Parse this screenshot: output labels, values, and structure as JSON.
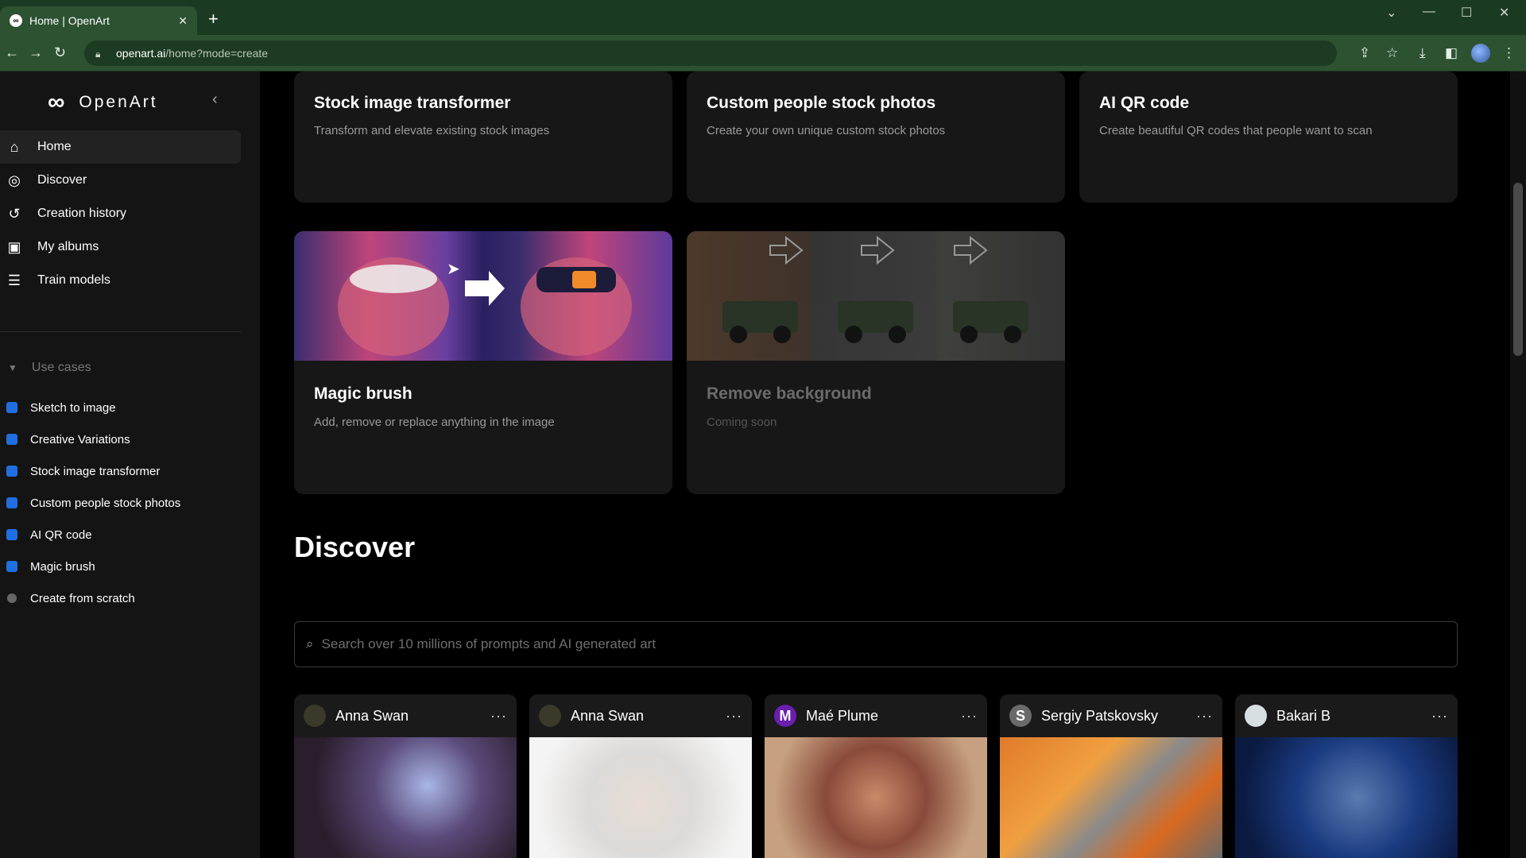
{
  "browser": {
    "tab_title": "Home | OpenArt",
    "tab_close": "✕",
    "new_tab": "+",
    "url_host": "openart.ai",
    "url_path": "/home?mode=create"
  },
  "sidebar": {
    "brand": "OpenArt",
    "nav": [
      {
        "label": "Home",
        "icon": "⌂"
      },
      {
        "label": "Discover",
        "icon": "◎"
      },
      {
        "label": "Creation history",
        "icon": "↺"
      },
      {
        "label": "My albums",
        "icon": "▣"
      },
      {
        "label": "Train models",
        "icon": "☰"
      }
    ],
    "use_cases_label": "Use cases",
    "use_cases": [
      "Sketch to image",
      "Creative Variations",
      "Stock image transformer",
      "Custom people stock photos",
      "AI QR code",
      "Magic brush",
      "Create from scratch"
    ]
  },
  "cards_top": [
    {
      "title": "Stock image transformer",
      "desc": "Transform and elevate existing stock images"
    },
    {
      "title": "Custom people stock photos",
      "desc": "Create your own unique custom stock photos"
    },
    {
      "title": "AI QR code",
      "desc": "Create beautiful QR codes that people want to scan"
    }
  ],
  "cards_mid": [
    {
      "title": "Magic brush",
      "desc": "Add, remove or replace anything in the image"
    },
    {
      "title": "Remove background",
      "desc": "Coming soon"
    }
  ],
  "discover": {
    "title": "Discover",
    "search_placeholder": "Search over 10 millions of prompts and AI generated art"
  },
  "artworks": [
    {
      "author": "Anna Swan",
      "avatar": "",
      "more": "···"
    },
    {
      "author": "Anna Swan",
      "avatar": "",
      "more": "···"
    },
    {
      "author": "Maé Plume",
      "avatar": "M",
      "more": "···"
    },
    {
      "author": "Sergiy Patskovsky",
      "avatar": "S",
      "more": "···"
    },
    {
      "author": "Bakari B",
      "avatar": "",
      "more": "···"
    }
  ],
  "colors": {
    "accent": "#1f6fe0",
    "browser_green": "#2c5231"
  }
}
